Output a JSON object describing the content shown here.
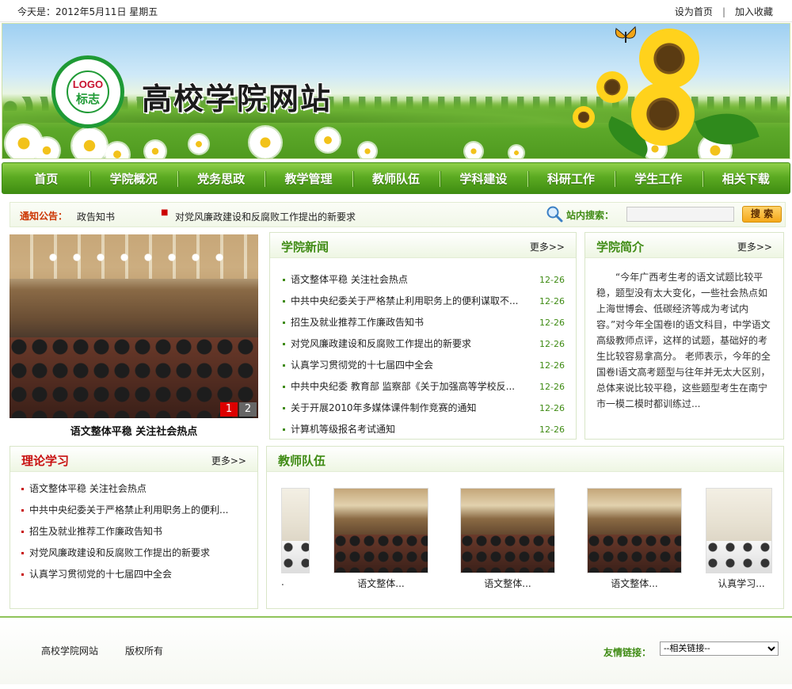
{
  "topbar": {
    "date": "今天是：2012年5月11日   星期五",
    "set_home": "设为首页",
    "separator": "|",
    "add_favorite": "加入收藏"
  },
  "banner": {
    "site_title": "高校学院网站",
    "logo_line1": "LOGO",
    "logo_line2": "标志"
  },
  "nav": {
    "items": [
      "首页",
      "学院概况",
      "党务思政",
      "教学管理",
      "教师队伍",
      "学科建设",
      "科研工作",
      "学生工作",
      "相关下载"
    ]
  },
  "notice": {
    "label": "通知公告：",
    "item1": "政告知书",
    "item2": "对党风廉政建设和反腐败工作提出的新要求",
    "search_label": "站内搜索：",
    "search_value": "",
    "search_button": "搜 索"
  },
  "slideshow": {
    "caption": "语文整体平稳  关注社会热点",
    "pages": [
      "1",
      "2"
    ]
  },
  "news": {
    "title": "学院新闻",
    "more": "更多>>",
    "items": [
      {
        "text": "语文整体平稳  关注社会热点",
        "date": "12-26"
      },
      {
        "text": "中共中央纪委关于严格禁止利用职务上的便利谋取不...",
        "date": "12-26"
      },
      {
        "text": "招生及就业推荐工作廉政告知书",
        "date": "12-26"
      },
      {
        "text": "对党风廉政建设和反腐败工作提出的新要求",
        "date": "12-26"
      },
      {
        "text": "认真学习贯彻党的十七届四中全会",
        "date": "12-26"
      },
      {
        "text": "中共中央纪委  教育部  监察部《关于加强高等学校反...",
        "date": "12-26"
      },
      {
        "text": "关于开展2010年多媒体课件制作竞赛的通知",
        "date": "12-26"
      },
      {
        "text": "计算机等级报名考试通知",
        "date": "12-26"
      }
    ]
  },
  "intro": {
    "title": "学院简介",
    "more": "更多>>",
    "body": "“今年广西考生考的语文试题比较平稳，题型没有太大变化，一些社会热点如上海世博会、低碳经济等成为考试内容。”对今年全国卷Ⅰ的语文科目，中学语文高级教师点评，这样的试题，基础好的考生比较容易拿高分。      老师表示，今年的全国卷Ⅰ语文高考题型与往年并无太大区别，总体来说比较平稳，这些题型考生在南宁市一模二模时都训练过..."
  },
  "theory": {
    "title": "理论学习",
    "more": "更多>>",
    "items": [
      "语文整体平稳  关注社会热点",
      "中共中央纪委关于严格禁止利用职务上的便利...",
      "招生及就业推荐工作廉政告知书",
      "对党风廉政建设和反腐败工作提出的新要求",
      "认真学习贯彻党的十七届四中全会"
    ]
  },
  "teachers": {
    "title": "教师队伍",
    "captions": [
      ".",
      "语文整体...",
      "语文整体...",
      "语文整体...",
      "认真学习..."
    ]
  },
  "footer": {
    "site_name": "高校学院网站",
    "copyright": "版权所有",
    "links_label": "友情链接：",
    "links_selected": "--相关链接--"
  },
  "colors": {
    "accent_green": "#3f8b14",
    "nav_green": "#5cab22",
    "notice_red": "#cc3300",
    "search_button": "#f5a81a"
  }
}
